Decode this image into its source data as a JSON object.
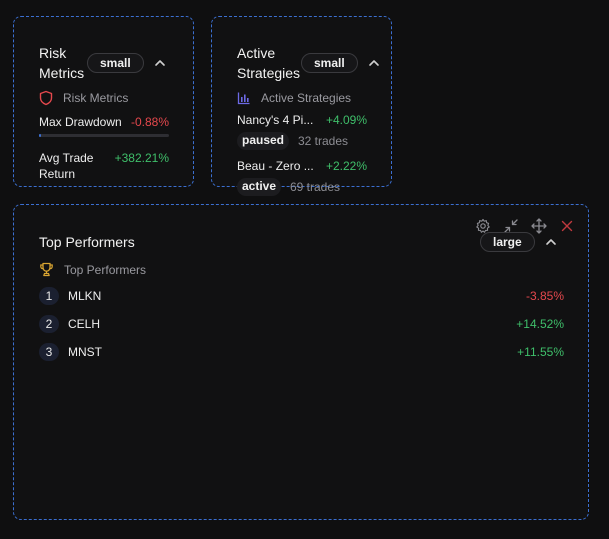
{
  "risk_metrics": {
    "title": "Risk Metrics",
    "size_label": "small",
    "subheading": "Risk Metrics",
    "rows": [
      {
        "label": "Max Drawdown",
        "value": "-0.88%",
        "bar_fraction": 0.01
      },
      {
        "label": "Avg Trade Return",
        "value": "+382.21%"
      }
    ]
  },
  "active_strategies": {
    "title": "Active Strategies",
    "size_label": "small",
    "subheading": "Active Strategies",
    "items": [
      {
        "name": "Nancy's 4 Pi...",
        "return": "+4.09%",
        "status": "paused",
        "trades": "32 trades"
      },
      {
        "name": "Beau - Zero ...",
        "return": "+2.22%",
        "status": "active",
        "trades": "69 trades"
      }
    ]
  },
  "top_performers": {
    "title": "Top Performers",
    "size_label": "large",
    "subheading": "Top Performers",
    "items": [
      {
        "rank": "1",
        "symbol": "MLKN",
        "change": "-3.85%"
      },
      {
        "rank": "2",
        "symbol": "CELH",
        "change": "+14.52%"
      },
      {
        "rank": "3",
        "symbol": "MNST",
        "change": "+11.55%"
      }
    ]
  },
  "colors": {
    "accent": "#3b6fd1",
    "negative": "#e5484d",
    "positive": "#3fbf6a",
    "trophy": "#d9a531",
    "shield": "#e5484d"
  },
  "icons": [
    "shield-icon",
    "bar-chart-icon",
    "trophy-icon",
    "settings-icon",
    "minimize-icon",
    "move-icon",
    "close-icon",
    "chevron-up-icon"
  ]
}
